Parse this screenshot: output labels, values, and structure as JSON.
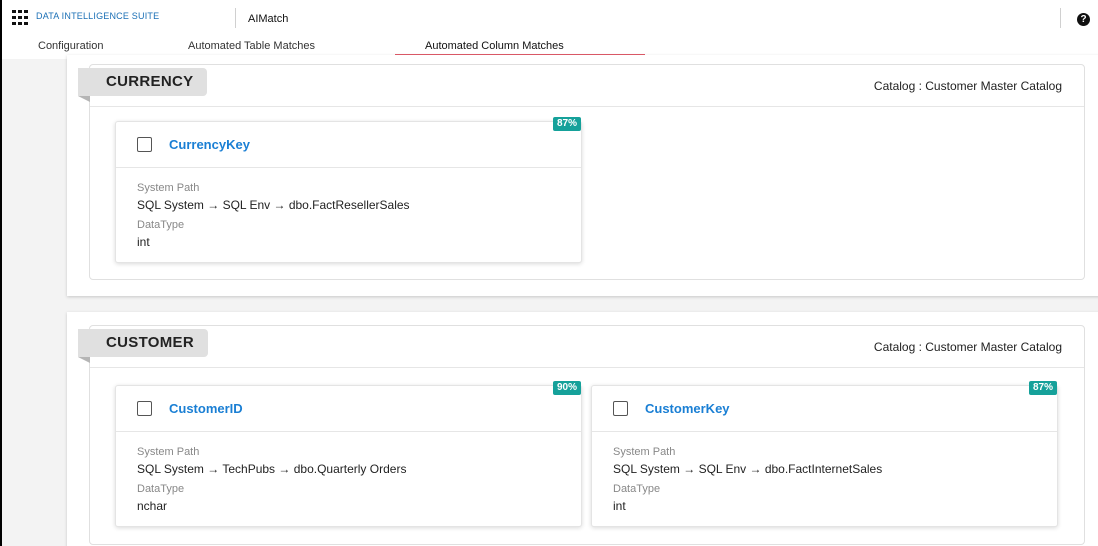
{
  "topbar": {
    "brand": "DATA INTELLIGENCE SUITE",
    "app_name": "AIMatch",
    "help_symbol": "?"
  },
  "tabs": [
    {
      "label": "Configuration",
      "active": false
    },
    {
      "label": "Automated Table Matches",
      "active": false
    },
    {
      "label": "Automated Column Matches",
      "active": true
    }
  ],
  "labels": {
    "system_path": "System Path",
    "data_type": "DataType"
  },
  "groups": [
    {
      "name": "CURRENCY",
      "catalog": "Catalog : Customer Master Catalog",
      "matches": [
        {
          "column": "CurrencyKey",
          "score": "87%",
          "system_path": "SQL System → SQL Env → dbo.FactResellerSales",
          "data_type": "int"
        }
      ]
    },
    {
      "name": "CUSTOMER",
      "catalog": "Catalog : Customer Master Catalog",
      "matches": [
        {
          "column": "CustomerID",
          "score": "90%",
          "system_path": "SQL System → TechPubs → dbo.Quarterly Orders",
          "data_type": "nchar"
        },
        {
          "column": "CustomerKey",
          "score": "87%",
          "system_path": "SQL System → SQL Env → dbo.FactInternetSales",
          "data_type": "int"
        }
      ]
    }
  ],
  "colors": {
    "brand": "#1a6fb5",
    "link": "#1a7fd4",
    "badge": "#15a19a",
    "active_tab_underline": "#e05c6a"
  },
  "icons": {
    "app_launcher": "grid-icon",
    "help": "help-icon"
  }
}
